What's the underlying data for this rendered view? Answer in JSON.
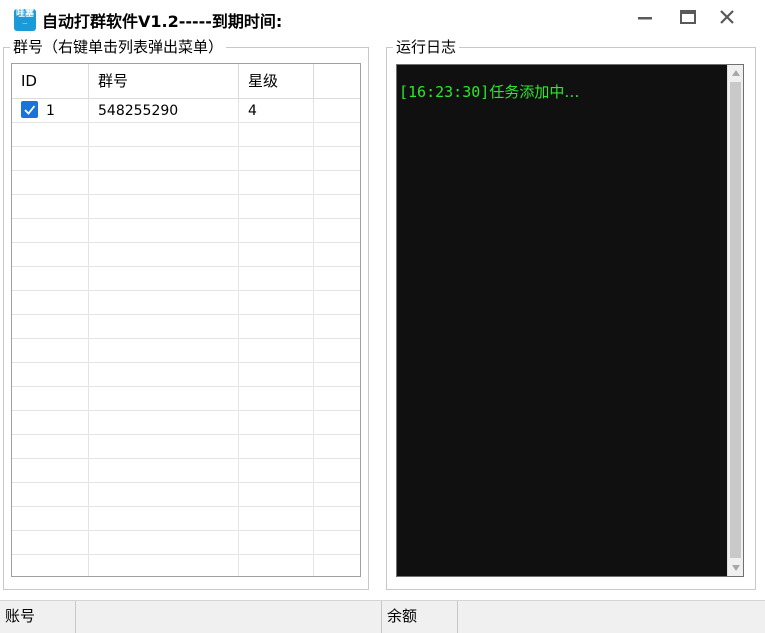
{
  "window": {
    "title": "自动打群软件V1.2-----到期时间:",
    "icon": "app-logo-icon",
    "icon_text_line1": "哇塞",
    "controls": [
      "minimize-icon",
      "maximize-icon",
      "close-icon"
    ]
  },
  "groups_panel": {
    "legend": "群号（右键单击列表弹出菜单）",
    "columns": [
      "ID",
      "群号",
      "星级",
      ""
    ],
    "rows": [
      {
        "checked": true,
        "id": "1",
        "group_number": "548255290",
        "stars": "4"
      }
    ]
  },
  "log_panel": {
    "legend": "运行日志",
    "entries": [
      {
        "time": "[16:23:30]",
        "message": "任务添加中…"
      }
    ],
    "text_color": "#2ee62e",
    "background": "#101010"
  },
  "statusbar": {
    "account_label": "账号",
    "account_value": "",
    "balance_label": "余额",
    "balance_value": ""
  }
}
